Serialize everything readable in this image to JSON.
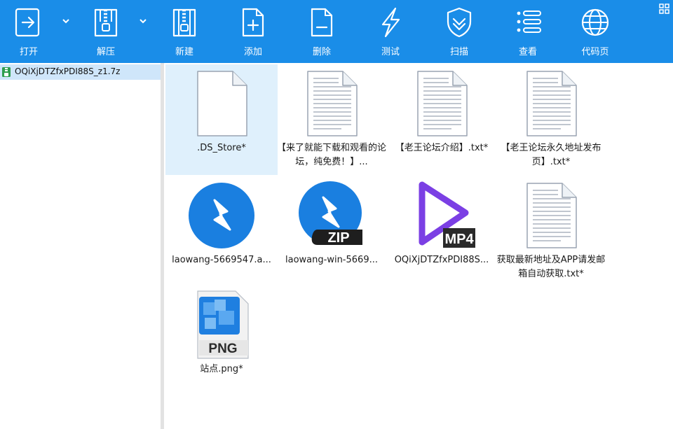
{
  "toolbar": {
    "open": "打开",
    "extract": "解压",
    "new": "新建",
    "add": "添加",
    "delete": "删除",
    "test": "测试",
    "scan": "扫描",
    "view": "查看",
    "code_page": "代码页"
  },
  "tree": {
    "archive_name": "OQiXjDTZfxPDI88S_z1.7z"
  },
  "files": [
    {
      "name": ".DS_Store*"
    },
    {
      "name": "【来了就能下载和观看的论坛，纯免费！】..."
    },
    {
      "name": "【老王论坛介绍】.txt*"
    },
    {
      "name": "【老王论坛永久地址发布页】.txt*"
    },
    {
      "name": "laowang-5669547.a...",
      "badge": ""
    },
    {
      "name": "laowang-win-5669...",
      "badge": "ZIP"
    },
    {
      "name": "OQiXjDTZfxPDI88S...",
      "badge": "MP4"
    },
    {
      "name": "获取最新地址及APP请发邮箱自动获取.txt*"
    },
    {
      "name": "站点.png*",
      "badge": "PNG"
    }
  ],
  "colors": {
    "toolbar": "#1a8de8",
    "selection": "#dff0fc",
    "app_blue": "#1a7fe0",
    "mp4_purple": "#7b3fe4"
  }
}
